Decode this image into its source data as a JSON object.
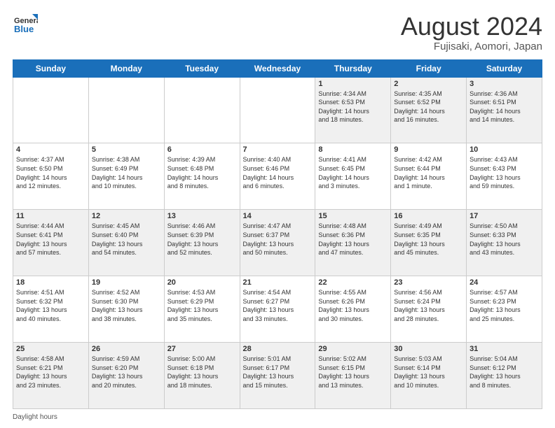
{
  "logo": {
    "general": "General",
    "blue": "Blue"
  },
  "title": "August 2024",
  "location": "Fujisaki, Aomori, Japan",
  "days_of_week": [
    "Sunday",
    "Monday",
    "Tuesday",
    "Wednesday",
    "Thursday",
    "Friday",
    "Saturday"
  ],
  "footer_text": "Daylight hours",
  "weeks": [
    [
      {
        "day": "",
        "info": "",
        "empty": true
      },
      {
        "day": "",
        "info": "",
        "empty": true
      },
      {
        "day": "",
        "info": "",
        "empty": true
      },
      {
        "day": "",
        "info": "",
        "empty": true
      },
      {
        "day": "1",
        "info": "Sunrise: 4:34 AM\nSunset: 6:53 PM\nDaylight: 14 hours\nand 18 minutes.",
        "empty": false
      },
      {
        "day": "2",
        "info": "Sunrise: 4:35 AM\nSunset: 6:52 PM\nDaylight: 14 hours\nand 16 minutes.",
        "empty": false
      },
      {
        "day": "3",
        "info": "Sunrise: 4:36 AM\nSunset: 6:51 PM\nDaylight: 14 hours\nand 14 minutes.",
        "empty": false
      }
    ],
    [
      {
        "day": "4",
        "info": "Sunrise: 4:37 AM\nSunset: 6:50 PM\nDaylight: 14 hours\nand 12 minutes.",
        "empty": false
      },
      {
        "day": "5",
        "info": "Sunrise: 4:38 AM\nSunset: 6:49 PM\nDaylight: 14 hours\nand 10 minutes.",
        "empty": false
      },
      {
        "day": "6",
        "info": "Sunrise: 4:39 AM\nSunset: 6:48 PM\nDaylight: 14 hours\nand 8 minutes.",
        "empty": false
      },
      {
        "day": "7",
        "info": "Sunrise: 4:40 AM\nSunset: 6:46 PM\nDaylight: 14 hours\nand 6 minutes.",
        "empty": false
      },
      {
        "day": "8",
        "info": "Sunrise: 4:41 AM\nSunset: 6:45 PM\nDaylight: 14 hours\nand 3 minutes.",
        "empty": false
      },
      {
        "day": "9",
        "info": "Sunrise: 4:42 AM\nSunset: 6:44 PM\nDaylight: 14 hours\nand 1 minute.",
        "empty": false
      },
      {
        "day": "10",
        "info": "Sunrise: 4:43 AM\nSunset: 6:43 PM\nDaylight: 13 hours\nand 59 minutes.",
        "empty": false
      }
    ],
    [
      {
        "day": "11",
        "info": "Sunrise: 4:44 AM\nSunset: 6:41 PM\nDaylight: 13 hours\nand 57 minutes.",
        "empty": false
      },
      {
        "day": "12",
        "info": "Sunrise: 4:45 AM\nSunset: 6:40 PM\nDaylight: 13 hours\nand 54 minutes.",
        "empty": false
      },
      {
        "day": "13",
        "info": "Sunrise: 4:46 AM\nSunset: 6:39 PM\nDaylight: 13 hours\nand 52 minutes.",
        "empty": false
      },
      {
        "day": "14",
        "info": "Sunrise: 4:47 AM\nSunset: 6:37 PM\nDaylight: 13 hours\nand 50 minutes.",
        "empty": false
      },
      {
        "day": "15",
        "info": "Sunrise: 4:48 AM\nSunset: 6:36 PM\nDaylight: 13 hours\nand 47 minutes.",
        "empty": false
      },
      {
        "day": "16",
        "info": "Sunrise: 4:49 AM\nSunset: 6:35 PM\nDaylight: 13 hours\nand 45 minutes.",
        "empty": false
      },
      {
        "day": "17",
        "info": "Sunrise: 4:50 AM\nSunset: 6:33 PM\nDaylight: 13 hours\nand 43 minutes.",
        "empty": false
      }
    ],
    [
      {
        "day": "18",
        "info": "Sunrise: 4:51 AM\nSunset: 6:32 PM\nDaylight: 13 hours\nand 40 minutes.",
        "empty": false
      },
      {
        "day": "19",
        "info": "Sunrise: 4:52 AM\nSunset: 6:30 PM\nDaylight: 13 hours\nand 38 minutes.",
        "empty": false
      },
      {
        "day": "20",
        "info": "Sunrise: 4:53 AM\nSunset: 6:29 PM\nDaylight: 13 hours\nand 35 minutes.",
        "empty": false
      },
      {
        "day": "21",
        "info": "Sunrise: 4:54 AM\nSunset: 6:27 PM\nDaylight: 13 hours\nand 33 minutes.",
        "empty": false
      },
      {
        "day": "22",
        "info": "Sunrise: 4:55 AM\nSunset: 6:26 PM\nDaylight: 13 hours\nand 30 minutes.",
        "empty": false
      },
      {
        "day": "23",
        "info": "Sunrise: 4:56 AM\nSunset: 6:24 PM\nDaylight: 13 hours\nand 28 minutes.",
        "empty": false
      },
      {
        "day": "24",
        "info": "Sunrise: 4:57 AM\nSunset: 6:23 PM\nDaylight: 13 hours\nand 25 minutes.",
        "empty": false
      }
    ],
    [
      {
        "day": "25",
        "info": "Sunrise: 4:58 AM\nSunset: 6:21 PM\nDaylight: 13 hours\nand 23 minutes.",
        "empty": false
      },
      {
        "day": "26",
        "info": "Sunrise: 4:59 AM\nSunset: 6:20 PM\nDaylight: 13 hours\nand 20 minutes.",
        "empty": false
      },
      {
        "day": "27",
        "info": "Sunrise: 5:00 AM\nSunset: 6:18 PM\nDaylight: 13 hours\nand 18 minutes.",
        "empty": false
      },
      {
        "day": "28",
        "info": "Sunrise: 5:01 AM\nSunset: 6:17 PM\nDaylight: 13 hours\nand 15 minutes.",
        "empty": false
      },
      {
        "day": "29",
        "info": "Sunrise: 5:02 AM\nSunset: 6:15 PM\nDaylight: 13 hours\nand 13 minutes.",
        "empty": false
      },
      {
        "day": "30",
        "info": "Sunrise: 5:03 AM\nSunset: 6:14 PM\nDaylight: 13 hours\nand 10 minutes.",
        "empty": false
      },
      {
        "day": "31",
        "info": "Sunrise: 5:04 AM\nSunset: 6:12 PM\nDaylight: 13 hours\nand 8 minutes.",
        "empty": false
      }
    ]
  ]
}
